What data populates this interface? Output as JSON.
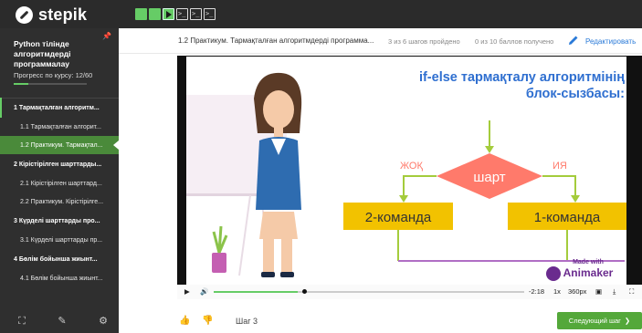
{
  "brand": {
    "name": "stepik"
  },
  "steps": [
    {
      "state": "done"
    },
    {
      "state": "done"
    },
    {
      "state": "active"
    },
    {
      "state": "code"
    },
    {
      "state": "code"
    },
    {
      "state": "code"
    }
  ],
  "sidebar": {
    "course_title": "Python тілінде алгоритмдерді программалау",
    "progress_label": "Прогресс по курсу:  12/60",
    "progress": {
      "done": 12,
      "total": 60
    },
    "items": [
      {
        "label": "1  Тармақталған алгоритм...",
        "type": "module"
      },
      {
        "label": "1.1  Тармақталған алгорит...",
        "type": "lesson"
      },
      {
        "label": "1.2  Практикум. Тармақтал...",
        "type": "lesson",
        "current": true
      },
      {
        "label": "2  Кірістірілген шарттарды...",
        "type": "module"
      },
      {
        "label": "2.1  Кірістірілген шарттард...",
        "type": "lesson"
      },
      {
        "label": "2.2  Практикум. Кірістірілге...",
        "type": "lesson"
      },
      {
        "label": "3  Күрделі шарттарды про...",
        "type": "module"
      },
      {
        "label": "3.1  Күрделі шарттарды пр...",
        "type": "lesson"
      },
      {
        "label": "4  Бөлім бойынша жиынт...",
        "type": "module"
      },
      {
        "label": "4.1  Бөлім бойынша жиынт...",
        "type": "lesson"
      }
    ],
    "footer_icons": [
      "expand-icon",
      "pencil-icon",
      "gear-icon"
    ]
  },
  "header": {
    "breadcrumb": "1.2 Практикум. Тармақталған алгоритмдерді программа...",
    "steps_passed": "3 из 6 шагов пройдено",
    "points": "0 из 10 баллов  получено",
    "edit_label": "Редактировать"
  },
  "video": {
    "slide_title_line1": "if-else тармақталу алгоритмінің",
    "slide_title_line2": "блок-сызбасы:",
    "cond_label": "шарт",
    "no_label": "ЖОҚ",
    "yes_label": "ИЯ",
    "box_left": "2-команда",
    "box_right": "1-команда",
    "badge_top": "Made with",
    "badge_bottom": "Animaker",
    "time": "-2:18",
    "speed": "1x",
    "quality": "360px",
    "progress": 0.27,
    "colors": {
      "accent": "#f2c200",
      "title": "#2f6fd0",
      "diamond": "#ff7a6b",
      "arrow": "#a4cc3c"
    }
  },
  "footer": {
    "step_label": "Шаг 3",
    "next_label": "Следующий шаг"
  }
}
